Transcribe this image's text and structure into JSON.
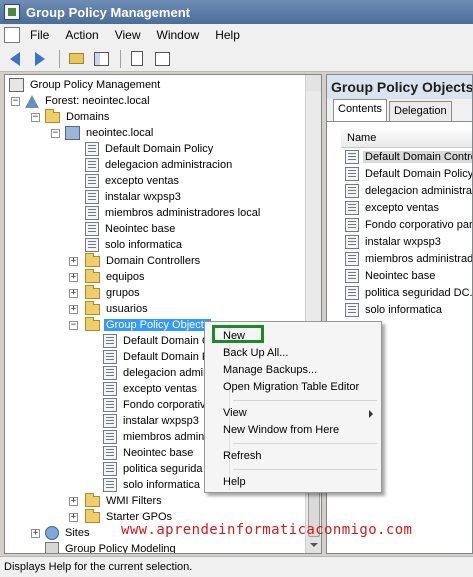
{
  "window": {
    "title": "Group Policy Management"
  },
  "menubar": {
    "items": [
      "File",
      "Action",
      "View",
      "Window",
      "Help"
    ]
  },
  "toolbar": {
    "icons": [
      "back-arrow-icon",
      "forward-arrow-icon",
      "up-folder-icon",
      "show-hide-tree-icon",
      "properties-icon",
      "help-icon"
    ]
  },
  "tree": {
    "root": "Group Policy Management",
    "forest": "Forest: neointec.local",
    "domains": "Domains",
    "domain": "neointec.local",
    "links": [
      "Default Domain Policy",
      "delegacion administracion",
      "excepto ventas",
      "instalar wxpsp3",
      "miembros administradores local",
      "Neointec base",
      "solo informatica"
    ],
    "folders": [
      "Domain Controllers",
      "equipos",
      "grupos",
      "usuarios"
    ],
    "gpo_container": "Group Policy Objects",
    "gpos": [
      "Default Domain C",
      "Default Domain P",
      "delegacion admin",
      "excepto ventas",
      "Fondo corporativ",
      "instalar wxpsp3",
      "miembros adminis",
      "Neointec base",
      "politica segurida",
      "solo informatica"
    ],
    "wmi_filters": "WMI Filters",
    "starter_gpos": "Starter GPOs",
    "sites": "Sites",
    "modeling": "Group Policy Modeling"
  },
  "right_pane": {
    "header": "Group Policy Objects",
    "tabs": [
      "Contents",
      "Delegation"
    ],
    "column": "Name",
    "items": [
      "Default Domain Control",
      "Default Domain Policy",
      "delegacion administra",
      "excepto ventas",
      "Fondo corporativo para",
      "instalar wxpsp3",
      "miembros administrador",
      "Neointec base",
      "politica seguridad DC.x",
      "solo informatica"
    ]
  },
  "context_menu": {
    "new": "New",
    "backup": "Back Up All...",
    "manage_backups": "Manage Backups...",
    "migration": "Open Migration Table Editor",
    "view": "View",
    "new_window": "New Window from Here",
    "refresh": "Refresh",
    "help": "Help"
  },
  "watermark": "www.aprendeinformaticaconmigo.com",
  "status": "Displays Help for the current selection.",
  "colors": {
    "accent_highlight": "#1a8a2a",
    "selection": "#3399ff",
    "watermark": "#d11a1a"
  }
}
